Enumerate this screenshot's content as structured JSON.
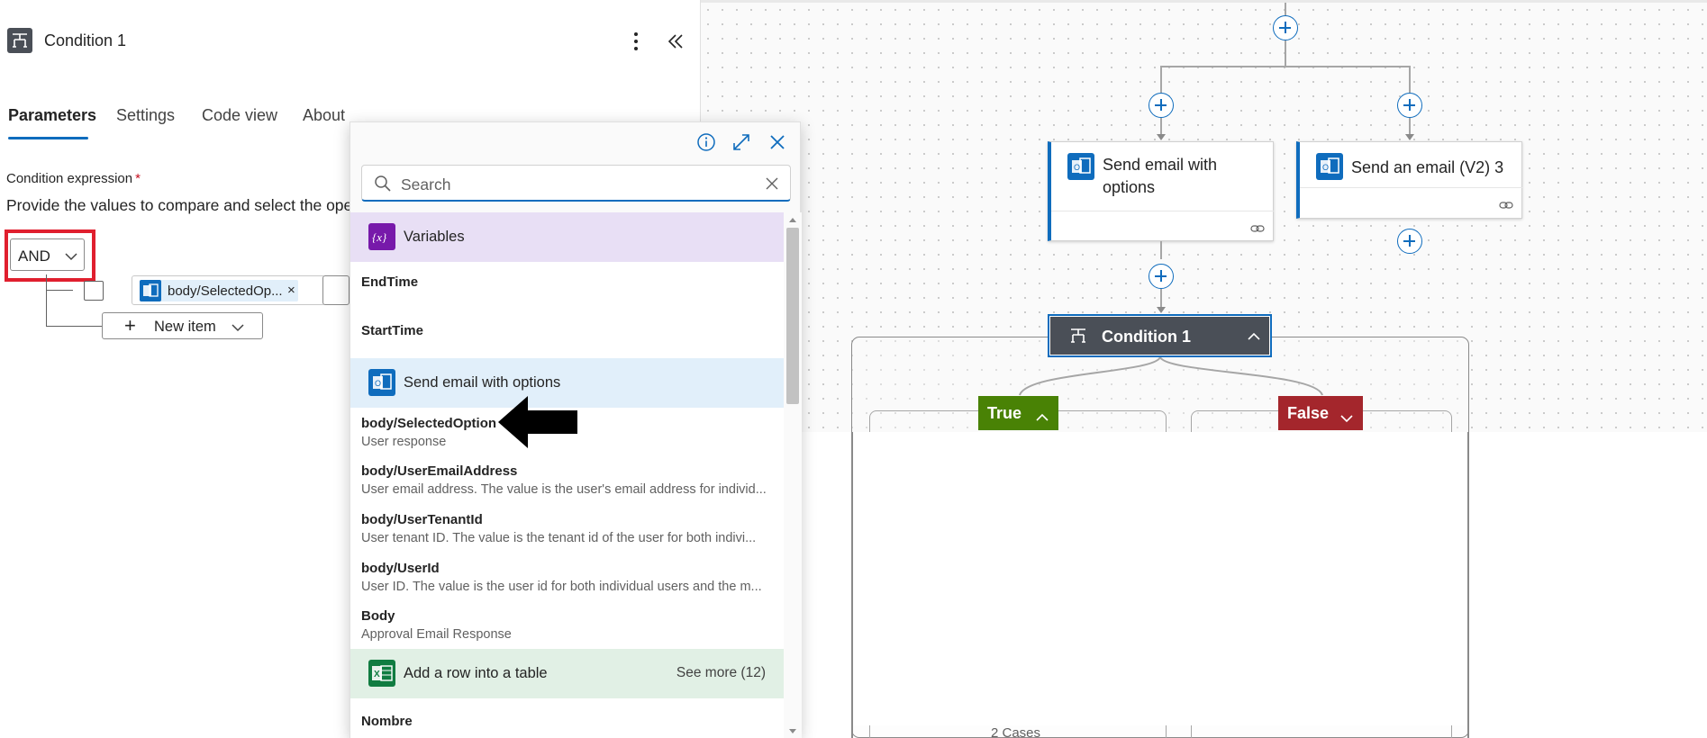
{
  "panel": {
    "title": "Condition 1",
    "tabs": [
      "Parameters",
      "Settings",
      "Code view",
      "About"
    ],
    "active_tab": "Parameters",
    "condition_label": "Condition expression",
    "required_marker": "*",
    "condition_description": "Provide the values to compare and select the ope",
    "group_operator": "AND",
    "row_token": "body/SelectedOp...",
    "token_remove": "×",
    "new_item_plus": "+",
    "new_item_label": "New item"
  },
  "popup": {
    "search_placeholder": "Search",
    "sections": [
      {
        "title": "Variables",
        "icon": "variables-icon",
        "color": "#e8dff5"
      },
      {
        "title": "Send email with options",
        "icon": "outlook-icon",
        "color": "#e1effa"
      },
      {
        "title": "Add a row into a table",
        "icon": "excel-icon",
        "color": "#e1f0e5",
        "see_more": "See more (12)"
      }
    ],
    "items": [
      {
        "title": "EndTime",
        "desc": ""
      },
      {
        "title": "StartTime",
        "desc": ""
      },
      {
        "title": "body/SelectedOption",
        "desc": "User response"
      },
      {
        "title": "body/UserEmailAddress",
        "desc": "User email address. The value is the user's email address for individ..."
      },
      {
        "title": "body/UserTenantId",
        "desc": "User tenant ID. The value is the tenant id of the user for both indivi..."
      },
      {
        "title": "body/UserId",
        "desc": "User ID. The value is the user id for both individual users and the m..."
      },
      {
        "title": "Body",
        "desc": "Approval Email Response"
      },
      {
        "title": "Nombre",
        "desc": ""
      }
    ]
  },
  "canvas": {
    "card_send_options": "Send email with options",
    "card_send_v2": "Send an email (V2) 3",
    "condition_node": "Condition 1",
    "true_label": "True",
    "false_label": "False",
    "cases_text": "2 Cases"
  },
  "colors": {
    "accent": "#0f6cbd",
    "highlight_red": "#e01f2e",
    "true_green": "#498205",
    "false_red": "#a4262c",
    "condition_dark": "#4a4f57"
  }
}
